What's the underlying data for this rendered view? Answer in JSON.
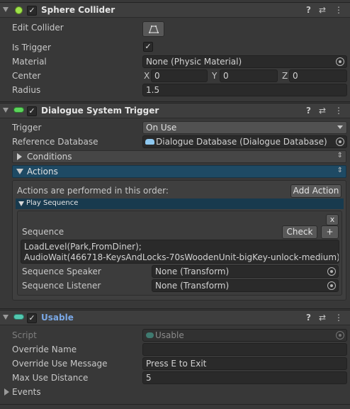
{
  "sphere_collider": {
    "title": "Sphere Collider",
    "enabled_checked": "✓",
    "edit_collider_label": "Edit Collider",
    "is_trigger_label": "Is Trigger",
    "is_trigger_checked": "✓",
    "material_label": "Material",
    "material_value": "None (Physic Material)",
    "center_label": "Center",
    "center": {
      "x_label": "X",
      "x": "0",
      "y_label": "Y",
      "y": "0",
      "z_label": "Z",
      "z": "0"
    },
    "radius_label": "Radius",
    "radius_value": "1.5"
  },
  "dialogue_trigger": {
    "title": "Dialogue System Trigger",
    "enabled_checked": "✓",
    "trigger_label": "Trigger",
    "trigger_value": "On Use",
    "reference_db_label": "Reference Database",
    "reference_db_value": "Dialogue Database (Dialogue Database)",
    "conditions_label": "Conditions",
    "actions_label": "Actions",
    "actions_order_text": "Actions are performed in this order:",
    "add_action_label": "Add Action",
    "play_sequence": {
      "title": "Play Sequence",
      "remove_label": "x",
      "sequence_label": "Sequence",
      "check_label": "Check",
      "plus_label": "+",
      "sequence_lines": [
        "LoadLevel(Park,FromDiner);",
        "AudioWait(466718-KeysAndLocks-70sWoodenUnit-bigKey-unlock-medium)"
      ],
      "speaker_label": "Sequence Speaker",
      "speaker_value": "None (Transform)",
      "listener_label": "Sequence Listener",
      "listener_value": "None (Transform)"
    }
  },
  "usable": {
    "title": "Usable",
    "enabled_checked": "✓",
    "script_label": "Script",
    "script_value": "Usable",
    "override_name_label": "Override Name",
    "override_name_value": "",
    "override_use_message_label": "Override Use Message",
    "override_use_message_value": "Press E to Exit",
    "max_use_distance_label": "Max Use Distance",
    "max_use_distance_value": "5",
    "events_label": "Events"
  },
  "header_icons": {
    "help": "?",
    "presets": "⇄",
    "menu": "⋮"
  },
  "colors": {
    "actions_header": "#1e4a64",
    "play_sequence_header": "#183a4e",
    "usable_title": "#7aa8e6",
    "sphere_icon": "#9ee24a",
    "dialogue_icon": "#5bd45b",
    "usable_icon": "#52c8b0"
  }
}
